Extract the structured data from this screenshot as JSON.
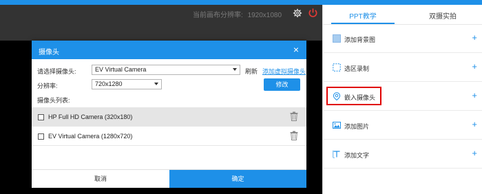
{
  "workspace": {
    "resolution_label": "当前画布分辨率:",
    "resolution_value": "1920x1080",
    "icons": [
      "gear-icon",
      "power-icon"
    ]
  },
  "dialog": {
    "title": "摄像头",
    "close_icon": "×",
    "select_camera_label": "请选择摄像头:",
    "selected_camera": "EV Virtual Camera",
    "refresh_link": "刷新",
    "add_virtual_link": "添加虚拟摄像头",
    "resolution_label": "分辨率:",
    "selected_resolution": "720x1280",
    "modify_button": "修改",
    "camera_list_label": "摄像头列表:",
    "cameras": [
      {
        "name": "HP Full HD Camera (320x180)",
        "selected": true
      },
      {
        "name": "EV Virtual Camera (1280x720)",
        "selected": false
      }
    ],
    "cancel_button": "取消",
    "ok_button": "确定"
  },
  "panel": {
    "tabs": [
      {
        "label": "PPT教学",
        "active": true
      },
      {
        "label": "双摄实拍",
        "active": false
      }
    ],
    "items": [
      {
        "label": "添加背景图",
        "icon": "background-image-icon"
      },
      {
        "label": "选区录制",
        "icon": "region-select-icon"
      },
      {
        "label": "嵌入摄像头",
        "icon": "camera-pin-icon"
      },
      {
        "label": "添加图片",
        "icon": "image-icon"
      },
      {
        "label": "添加文字",
        "icon": "text-icon"
      }
    ],
    "plus": "+"
  },
  "colors": {
    "accent": "#1e90e8",
    "workspace_bg": "#333333",
    "highlight": "#e00000",
    "power": "#e53935"
  }
}
